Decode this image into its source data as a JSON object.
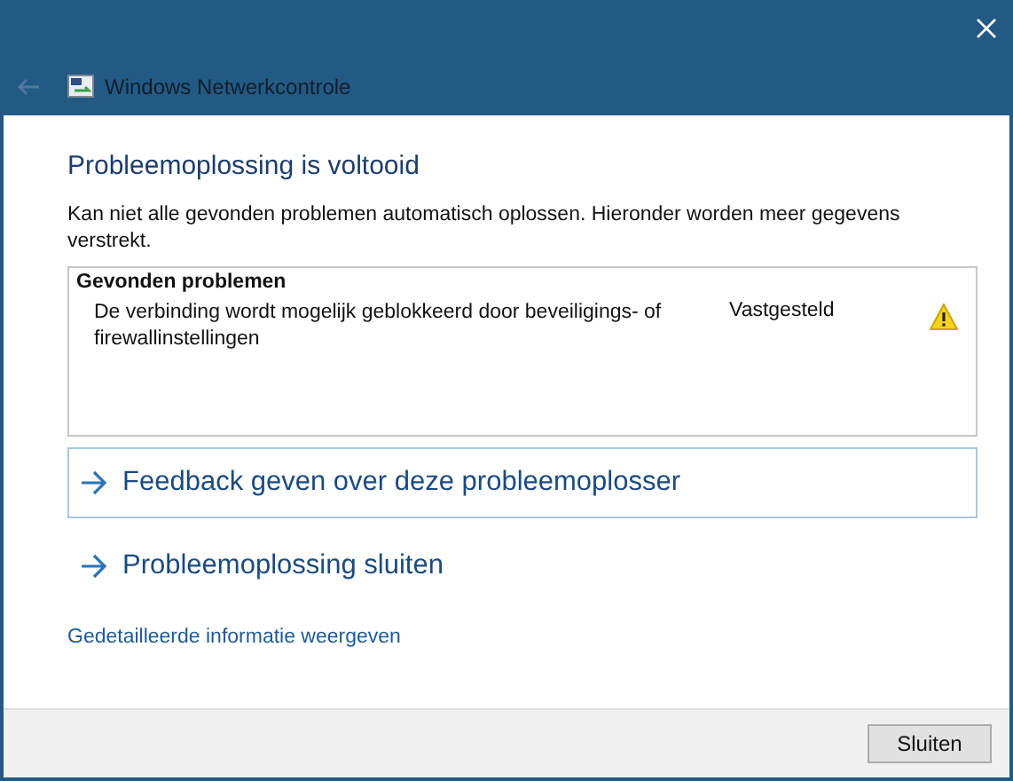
{
  "window": {
    "title": "Windows Netwerkcontrole",
    "back_disabled": true
  },
  "heading": "Probleemoplossing is voltooid",
  "description": "Kan niet alle gevonden problemen automatisch oplossen. Hieronder worden meer gegevens verstrekt.",
  "problems": {
    "title": "Gevonden problemen",
    "items": [
      {
        "text": "De verbinding wordt mogelijk geblokkeerd door beveiligings- of firewallinstellingen",
        "status": "Vastgesteld",
        "kind": "warning"
      }
    ]
  },
  "actions": [
    {
      "label": "Feedback geven over deze probleemoplosser",
      "selected": true
    },
    {
      "label": "Probleemoplossing sluiten",
      "selected": false
    }
  ],
  "details_link": "Gedetailleerde informatie weergeven",
  "buttons": [
    "Sluiten"
  ]
}
